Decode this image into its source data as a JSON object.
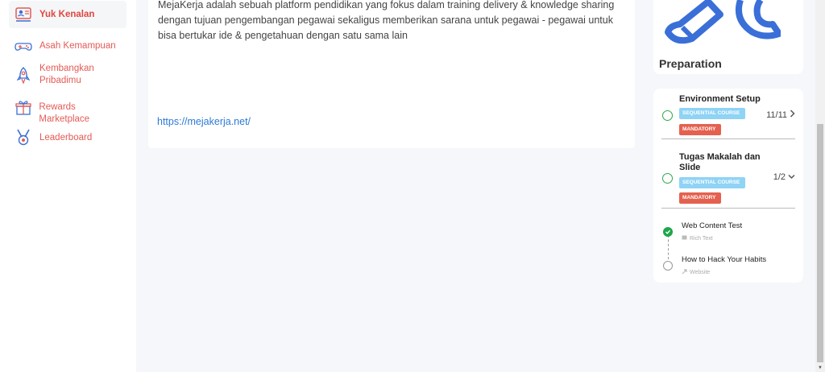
{
  "sidebar": {
    "items": [
      {
        "label": "Yuk Kenalan",
        "icon": "id-card-icon",
        "active": true
      },
      {
        "label": "Asah Kemampuan",
        "icon": "gamepad-icon"
      },
      {
        "label": "Kembangkan Pribadimu",
        "icon": "rocket-icon"
      },
      {
        "label": "Rewards Marketplace",
        "icon": "gift-icon"
      },
      {
        "label": "Leaderboard",
        "icon": "medal-icon"
      }
    ]
  },
  "main": {
    "description": "MejaKerja adalah sebuah platform pendidikan yang fokus dalam training delivery & knowledge sharing dengan tujuan pengembangan pegawai sekaligus memberikan sarana untuk pegawai - pegawai untuk bisa bertukar ide & pengetahuan dengan satu sama lain",
    "link": "https://mejakerja.net/"
  },
  "preparation": {
    "title": "Preparation",
    "illustration": "pencil-wrench-icon"
  },
  "courses": [
    {
      "title": "Environment Setup",
      "badges": [
        "SEQUENTIAL COURSE",
        "MANDATORY"
      ],
      "count": "11/11",
      "chevron": "chevron-right-icon"
    },
    {
      "title": "Tugas Makalah dan Slide",
      "badges": [
        "SEQUENTIAL COURSE",
        "MANDATORY"
      ],
      "count": "1/2",
      "chevron": "chevron-down-icon"
    }
  ],
  "subitems": [
    {
      "title": "Web Content Test",
      "type": "Rich Text",
      "done": true
    },
    {
      "title": "How to Hack Your Habits",
      "type": "Website",
      "done": false
    }
  ],
  "colors": {
    "accent": "#e45a55",
    "link": "#2d7ad6",
    "success": "#1fa64a",
    "mandatory": "#e4614f",
    "sequential": "#8fd3f5"
  }
}
